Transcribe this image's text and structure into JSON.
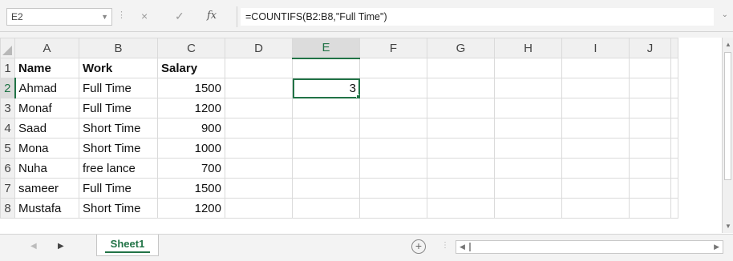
{
  "formula_bar": {
    "name_box": "E2",
    "cancel_icon": "×",
    "enter_icon": "✓",
    "fx_label": "fx",
    "formula": "=COUNTIFS(B2:B8,\"Full Time\")"
  },
  "columns": [
    "A",
    "B",
    "C",
    "D",
    "E",
    "F",
    "G",
    "H",
    "I",
    "J"
  ],
  "rows": [
    {
      "num": "1",
      "cells": [
        "Name",
        "Work",
        "Salary",
        "",
        "",
        "",
        "",
        "",
        "",
        ""
      ]
    },
    {
      "num": "2",
      "cells": [
        "Ahmad",
        "Full Time",
        "1500",
        "",
        "3",
        "",
        "",
        "",
        "",
        ""
      ]
    },
    {
      "num": "3",
      "cells": [
        "Monaf",
        "Full Time",
        "1200",
        "",
        "",
        "",
        "",
        "",
        "",
        ""
      ]
    },
    {
      "num": "4",
      "cells": [
        "Saad",
        "Short Time",
        "900",
        "",
        "",
        "",
        "",
        "",
        "",
        ""
      ]
    },
    {
      "num": "5",
      "cells": [
        "Mona",
        "Short Time",
        "1000",
        "",
        "",
        "",
        "",
        "",
        "",
        ""
      ]
    },
    {
      "num": "6",
      "cells": [
        "Nuha",
        "free lance",
        "700",
        "",
        "",
        "",
        "",
        "",
        "",
        ""
      ]
    },
    {
      "num": "7",
      "cells": [
        "sameer",
        "Full Time",
        "1500",
        "",
        "",
        "",
        "",
        "",
        "",
        ""
      ]
    },
    {
      "num": "8",
      "cells": [
        "Mustafa",
        "Short Time",
        "1200",
        "",
        "",
        "",
        "",
        "",
        "",
        ""
      ]
    }
  ],
  "active_cell": {
    "column": "E",
    "row": "2"
  },
  "sheet_tabs": [
    "Sheet1"
  ],
  "add_sheet_label": "+",
  "colors": {
    "accent": "#217346"
  }
}
